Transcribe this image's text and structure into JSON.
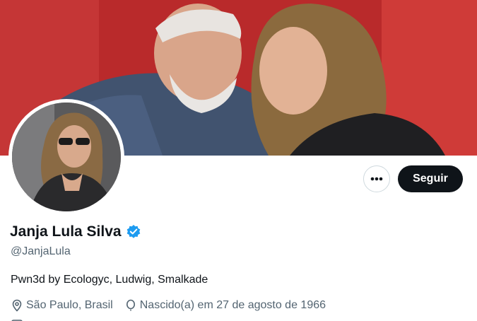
{
  "profile": {
    "display_name": "Janja Lula Silva",
    "handle": "@JanjaLula",
    "verified": true,
    "bio": "Pwn3d by Ecologyc, Ludwig, Smalkade",
    "location": "São Paulo, Brasil",
    "birth": "Nascido(a) em 27 de agosto de 1966"
  },
  "actions": {
    "follow_label": "Seguir",
    "more_icon": "more-horizontal-icon"
  },
  "colors": {
    "verified_badge": "#1d9bf0",
    "follow_button_bg": "#0f1419",
    "secondary_text": "#536471",
    "banner_red": "#c33a36"
  }
}
